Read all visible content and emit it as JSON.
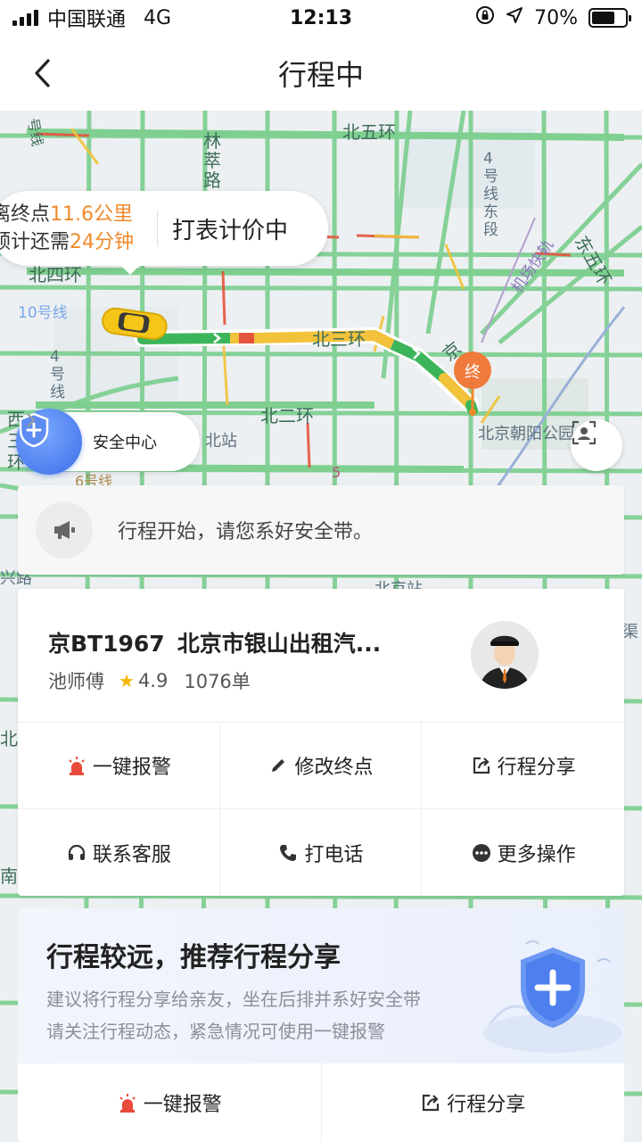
{
  "status_bar": {
    "carrier": "中国联通",
    "network": "4G",
    "time": "12:13",
    "battery_text": "70%",
    "battery_level": 0.7
  },
  "nav": {
    "title": "行程中",
    "back_icon": "chevron-left-icon"
  },
  "map": {
    "labels": {
      "line4": "号线",
      "lin": "林",
      "cui": "萃",
      "lu": "路",
      "n5ring": "北五环",
      "l4east": [
        "4",
        "号",
        "线",
        "东",
        "段"
      ],
      "airport": "机场快轨",
      "e5ring": "东五环",
      "n4ring": "北四环",
      "line10": "10号线",
      "line4b": [
        "4",
        "号",
        "线"
      ],
      "n3ring": "北三环",
      "n2ring": "北二环",
      "north_station": "北站",
      "chaoyang_park": "北京朝阳公园",
      "jing": "京",
      "west": "西",
      "san": "三",
      "huan": "环",
      "line6": "6号线",
      "line5": "5",
      "xing": "兴路",
      "beijing_station": "北京站",
      "qu": "渠",
      "bei": "北",
      "nan": "南"
    },
    "destination_marker": "终",
    "trip_bubble": {
      "distance_prefix": "离终点",
      "distance": "11.6公里",
      "eta_prefix": "预计还需",
      "eta": "24分钟",
      "status": "打表计价中"
    },
    "safety_center": {
      "label": "安全中心",
      "icon": "shield-plus-icon",
      "chevron": "chevron-right-icon"
    },
    "locate_icon": "locate-icon"
  },
  "notice": {
    "icon": "megaphone-icon",
    "text": "行程开始，请您系好安全带。"
  },
  "driver": {
    "plate": "京BT1967",
    "company": "北京市银山出租汽...",
    "name": "池师傅",
    "rating": "4.9",
    "orders": "1076单",
    "avatar_icon": "driver-avatar-icon"
  },
  "actions": [
    {
      "label": "一键报警",
      "icon": "alarm-icon",
      "color": "#e94a3b"
    },
    {
      "label": "修改终点",
      "icon": "pencil-icon",
      "color": "#333333"
    },
    {
      "label": "行程分享",
      "icon": "share-icon",
      "color": "#333333"
    },
    {
      "label": "联系客服",
      "icon": "headset-icon",
      "color": "#333333"
    },
    {
      "label": "打电话",
      "icon": "phone-icon",
      "color": "#333333"
    },
    {
      "label": "更多操作",
      "icon": "more-icon",
      "color": "#333333"
    }
  ],
  "share_card": {
    "title": "行程较远，推荐行程分享",
    "line1": "建议将行程分享给亲友，坐在后排并系好安全带",
    "line2": "请关注行程动态，紧急情况可使用一键报警",
    "illustration": "shield-plus-icon",
    "buttons": [
      {
        "label": "一键报警",
        "icon": "alarm-icon"
      },
      {
        "label": "行程分享",
        "icon": "share-icon"
      }
    ]
  },
  "colors": {
    "accent_orange": "#f08a2c",
    "route_green": "#3cb55a",
    "route_yellow": "#f2c23a",
    "route_red": "#e4543c",
    "shield_blue": "#3c6ee8"
  }
}
